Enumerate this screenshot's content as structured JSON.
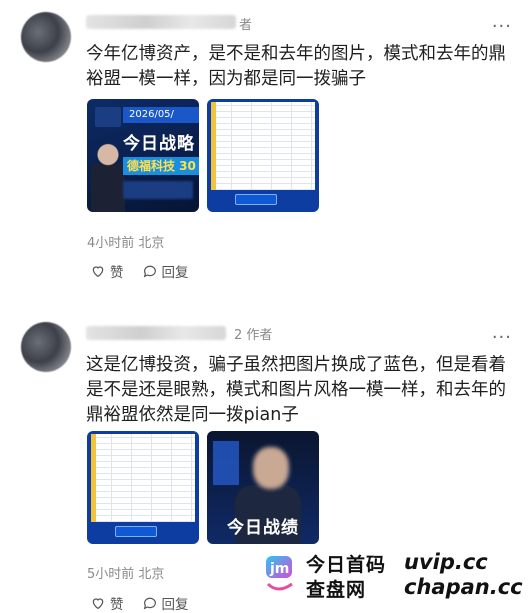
{
  "comments": [
    {
      "author_tag": "者",
      "more": "···",
      "text": "今年亿博资产，是不是和去年的图片，模式和去年的鼎裕盟一模一样，因为都是同一拨骗子",
      "images": [
        {
          "kind": "promo",
          "date": "2026/05/",
          "title": "今日战略",
          "stock": "德福科技 30"
        },
        {
          "kind": "table"
        }
      ],
      "meta": "4小时前 北京",
      "like": "赞",
      "reply": "回复"
    },
    {
      "author_tag": "2  作者",
      "more": "···",
      "text": "这是亿博投资，骗子虽然把图片换成了蓝色，但是看着是不是还是眼熟，模式和图片风格一模一样，和去年的鼎裕盟依然是同一拨pian子",
      "images": [
        {
          "kind": "table"
        },
        {
          "kind": "dark",
          "title": "今日战绩"
        }
      ],
      "meta": "5小时前 北京",
      "like": "赞",
      "reply": "回复"
    }
  ],
  "watermark": {
    "line1_cn": "今日首码",
    "line2_cn": "查盘网",
    "line1_en": "uvip.cc",
    "line2_en": "chapan.cc"
  }
}
